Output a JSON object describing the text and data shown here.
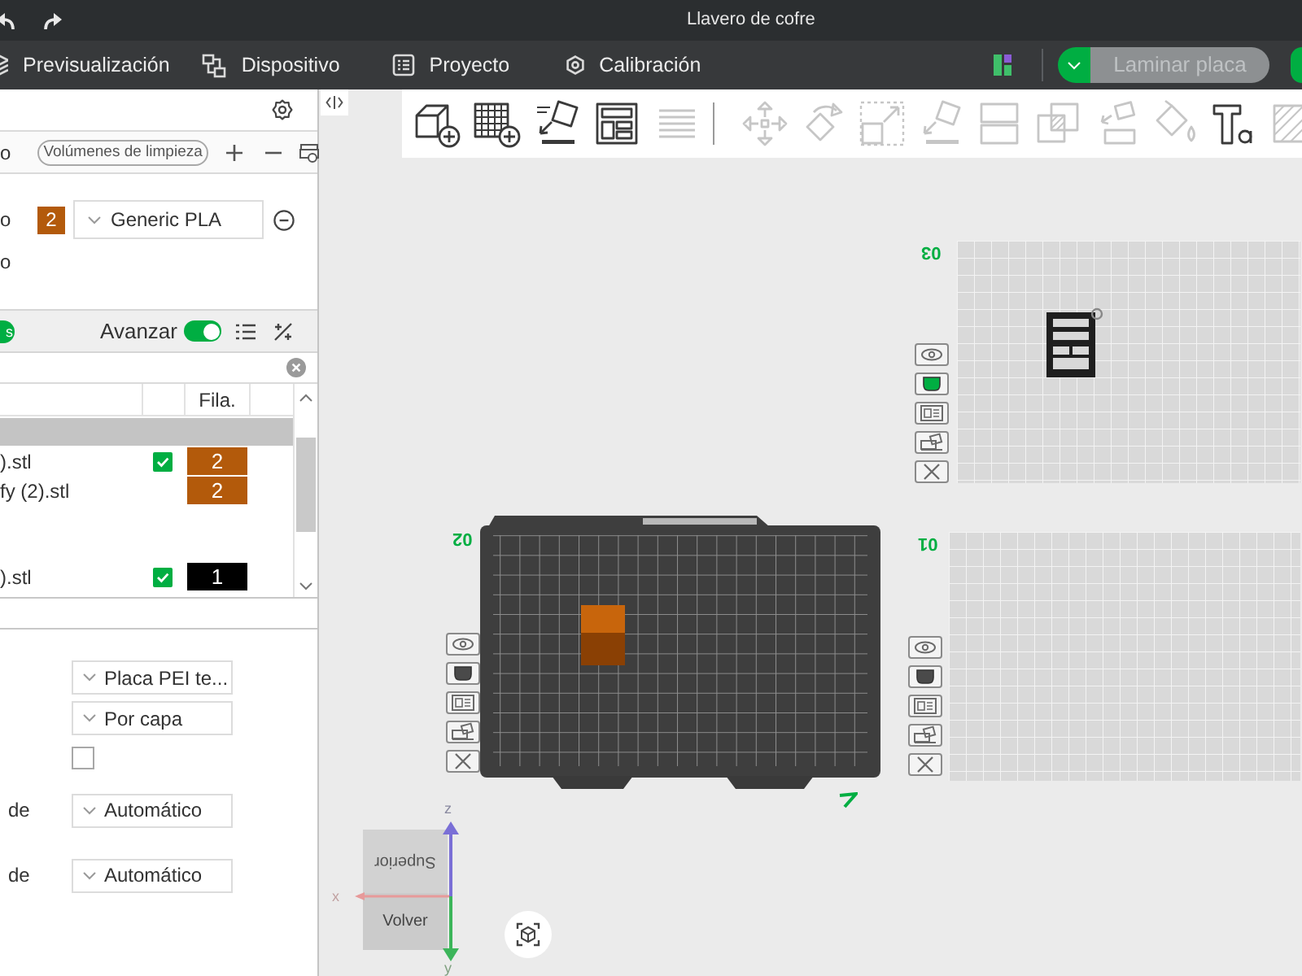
{
  "window": {
    "title": "Llavero de cofre"
  },
  "menu": [
    {
      "label": "Previsualización"
    },
    {
      "label": "Dispositivo"
    },
    {
      "label": "Proyecto"
    },
    {
      "label": "Calibración"
    }
  ],
  "slice_button": {
    "label": "Laminar placa",
    "disabled": true
  },
  "filament_panel": {
    "header_label": "o",
    "purge_button": "Volúmenes de limpieza",
    "filaments": [
      {
        "label": "o",
        "number": "2",
        "color": "#b35a0b",
        "name": "Generic PLA"
      }
    ],
    "footer_label": "o"
  },
  "objects_panel": {
    "badge": "s",
    "advance": {
      "label": "Avanzar",
      "on": true
    },
    "filament_column": "Fila.",
    "rows": [
      {
        "kind": "plate"
      },
      {
        "kind": "object",
        "name": ").stl",
        "checked": true,
        "filament": "2",
        "color": "#b35a0b"
      },
      {
        "kind": "part",
        "name": "fy (2).stl",
        "filament": "2",
        "color": "#b35a0b"
      },
      {
        "kind": "object",
        "name": ").stl",
        "checked": true,
        "filament": "1",
        "color": "#000000"
      }
    ]
  },
  "plate_settings": [
    {
      "kind": "select",
      "value": "Placa PEI te..."
    },
    {
      "kind": "select",
      "value": "Por capa"
    },
    {
      "kind": "checkbox",
      "checked": false
    },
    {
      "kind": "select",
      "label": "de",
      "value": "Automático"
    },
    {
      "kind": "select",
      "label": "de",
      "value": "Automático"
    }
  ],
  "toolbar": {
    "object_tools": [
      {
        "disabled": false
      },
      {
        "disabled": false
      },
      {
        "disabled": false
      },
      {
        "disabled": false
      },
      {
        "disabled": true
      }
    ],
    "edit_tools": [
      {
        "disabled": true
      },
      {
        "disabled": true
      },
      {
        "disabled": true
      },
      {
        "disabled": true
      },
      {
        "disabled": true
      },
      {
        "disabled": true
      },
      {
        "disabled": true
      },
      {
        "disabled": true
      },
      {
        "disabled": false
      },
      {
        "disabled": true
      }
    ]
  },
  "plates": [
    {
      "label": "03",
      "selected": false,
      "settings_on": true,
      "objects": [
        {
          "kind": "keychain"
        }
      ]
    },
    {
      "label": "02",
      "selected": true,
      "settings_on": false,
      "objects": [
        {
          "kind": "box"
        }
      ]
    },
    {
      "label": "01",
      "selected": false,
      "settings_on": false
    }
  ],
  "view_cube": {
    "top": "Superior",
    "front": "Volver"
  },
  "axes": {
    "z": "z",
    "x": "x",
    "y": "y"
  }
}
